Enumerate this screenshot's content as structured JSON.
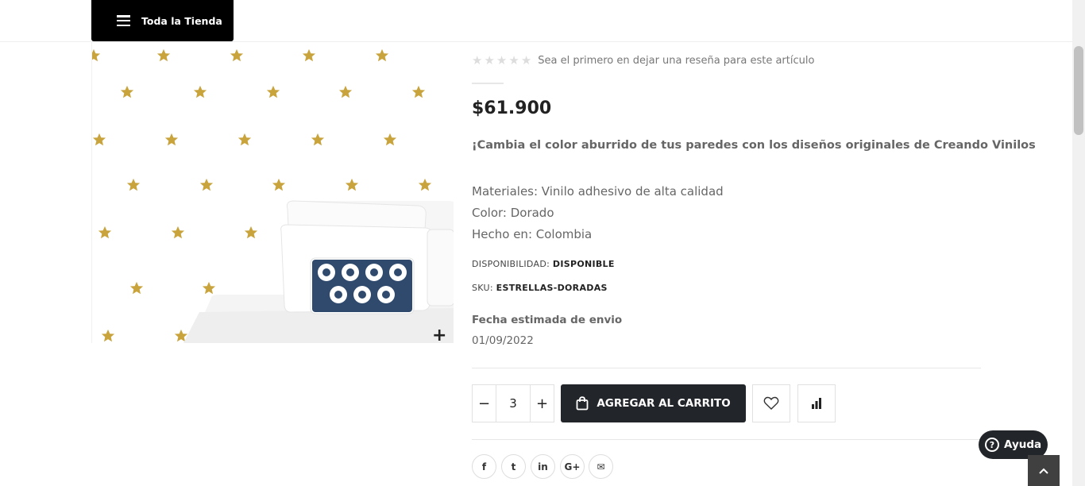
{
  "header": {
    "store_button_label": "Toda la Tienda",
    "menu_icon": "hamburger-icon"
  },
  "product": {
    "rating_stars": 0,
    "rating_max": 5,
    "review_link": "Sea el primero en dejar una reseña para este artículo",
    "price": "$61.900",
    "tagline": "¡Cambia el color aburrido de tus paredes con los diseños originales de Creando Vinilos",
    "specs": [
      "Materiales: Vinilo adhesivo de alta calidad",
      "Color: Dorado",
      "Hecho en: Colombia"
    ],
    "availability_label": "DISPONIBILIDAD:",
    "availability_value": "DISPONIBLE",
    "sku_label": "SKU:",
    "sku_value": "ESTRELLAS-DORADAS",
    "ship_title": "Fecha estimada de envio",
    "ship_date": "01/09/2022",
    "quantity": "3",
    "minus_label": "−",
    "plus_label": "+",
    "add_to_cart": "AGREGAR AL CARRITO",
    "zoom_label": "+"
  },
  "share": {
    "facebook": "f",
    "twitter": "t",
    "linkedin": "in",
    "googleplus": "G+",
    "email": "✉"
  },
  "help": {
    "label": "Ayuda",
    "icon": "?"
  },
  "colors": {
    "accent_dark": "#222529",
    "star_gold": "#C9A43D"
  }
}
